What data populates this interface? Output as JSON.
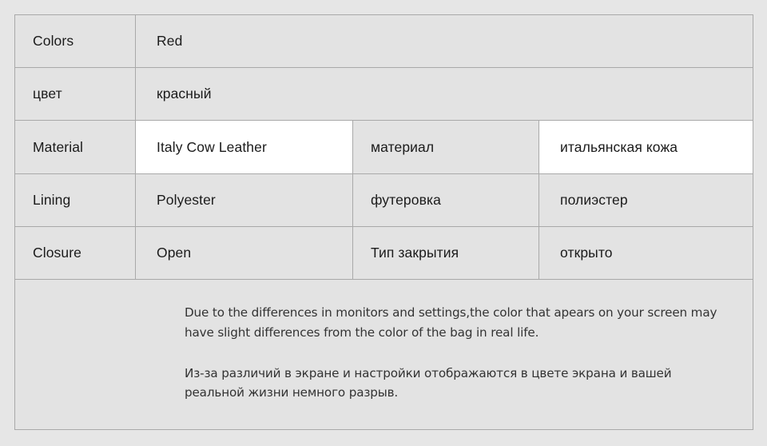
{
  "colors": {
    "page_background": "#e6e6e6",
    "cell_background": "#e3e3e3",
    "highlight_background": "#ffffff",
    "border": "#a9a9a9",
    "text": "#1b1b1b",
    "note_text": "#333333"
  },
  "spec_table": {
    "rows": [
      {
        "label_en": "Colors",
        "value_en": "Red",
        "value_en_highlight": false,
        "full_span": true
      },
      {
        "label_ru": "цвет",
        "value_ru": "красный",
        "value_ru_highlight": false,
        "full_span": true
      },
      {
        "label_en": "Material",
        "value_en": "Italy Cow Leather",
        "value_en_highlight": true,
        "label_ru": "материал",
        "value_ru": "итальянская кожа",
        "value_ru_highlight": true,
        "full_span": false
      },
      {
        "label_en": "Lining",
        "value_en": "Polyester",
        "value_en_highlight": false,
        "label_ru": "футеровка",
        "value_ru": "полиэстер",
        "value_ru_highlight": false,
        "full_span": false
      },
      {
        "label_en": "Closure",
        "value_en": "Open",
        "value_en_highlight": false,
        "label_ru": "Тип закрытия",
        "value_ru": "открыто",
        "value_ru_highlight": false,
        "full_span": false
      }
    ]
  },
  "note": {
    "english": "Due to the differences in monitors and settings,the color that apears on your screen may have slight differences from the color of the bag in real life.",
    "russian": "Из-за различий в экране и настройки отображаются в цвете экрана и вашей реальной жизни немного разрыв."
  }
}
